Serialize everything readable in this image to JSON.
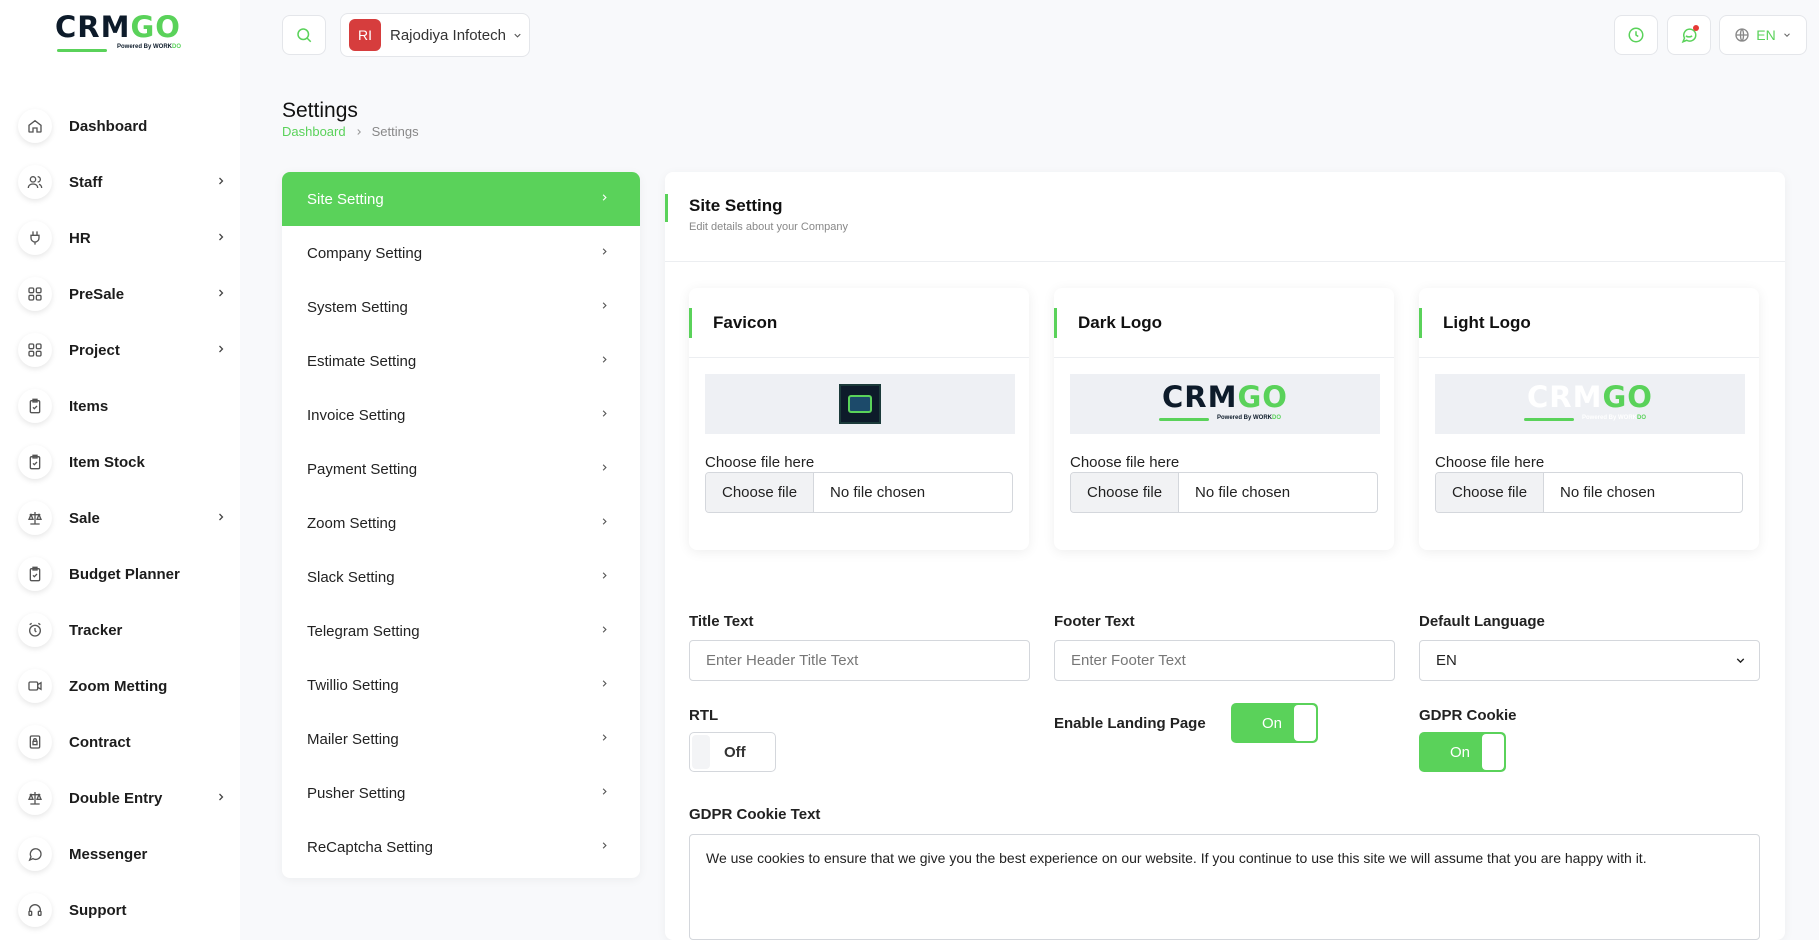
{
  "brand": {
    "word_part1": "CRM",
    "word_part2": "GO",
    "powered_by": "Powered By ",
    "powered_brand_part1": "WORK",
    "powered_brand_part2": "DO",
    "accent_color": "#5ad25a"
  },
  "sidebar": {
    "items": [
      {
        "label": "Dashboard",
        "icon": "home-icon",
        "has_children": false
      },
      {
        "label": "Staff",
        "icon": "users-icon",
        "has_children": true
      },
      {
        "label": "HR",
        "icon": "plug-icon",
        "has_children": true
      },
      {
        "label": "PreSale",
        "icon": "grid-icon",
        "has_children": true
      },
      {
        "label": "Project",
        "icon": "grid-icon",
        "has_children": true
      },
      {
        "label": "Items",
        "icon": "clipboard-check-icon",
        "has_children": false
      },
      {
        "label": "Item Stock",
        "icon": "clipboard-check-icon",
        "has_children": false
      },
      {
        "label": "Sale",
        "icon": "scale-icon",
        "has_children": true
      },
      {
        "label": "Budget Planner",
        "icon": "clipboard-check-icon",
        "has_children": false
      },
      {
        "label": "Tracker",
        "icon": "alarm-clock-icon",
        "has_children": false
      },
      {
        "label": "Zoom Metting",
        "icon": "video-icon",
        "has_children": false
      },
      {
        "label": "Contract",
        "icon": "file-lock-icon",
        "has_children": false
      },
      {
        "label": "Double Entry",
        "icon": "scale-icon",
        "has_children": true
      },
      {
        "label": "Messenger",
        "icon": "chat-bubble-icon",
        "has_children": false
      },
      {
        "label": "Support",
        "icon": "headset-icon",
        "has_children": false
      }
    ]
  },
  "topbar": {
    "company_initials": "RI",
    "company_name": "Rajodiya Infotech",
    "language": "EN"
  },
  "page": {
    "title": "Settings",
    "breadcrumb_home": "Dashboard",
    "breadcrumb_current": "Settings"
  },
  "settings_menu": {
    "items": [
      {
        "label": "Site Setting",
        "active": true
      },
      {
        "label": "Company Setting"
      },
      {
        "label": "System Setting"
      },
      {
        "label": "Estimate Setting"
      },
      {
        "label": "Invoice Setting"
      },
      {
        "label": "Payment Setting"
      },
      {
        "label": "Zoom Setting"
      },
      {
        "label": "Slack Setting"
      },
      {
        "label": "Telegram Setting"
      },
      {
        "label": "Twillio Setting"
      },
      {
        "label": "Mailer Setting"
      },
      {
        "label": "Pusher Setting"
      },
      {
        "label": "ReCaptcha Setting"
      }
    ]
  },
  "panel": {
    "title": "Site Setting",
    "subtitle": "Edit details about your Company",
    "cards": [
      {
        "title": "Favicon",
        "file_label": "Choose file here",
        "button": "Choose file",
        "file_status": "No file chosen"
      },
      {
        "title": "Dark Logo",
        "file_label": "Choose file here",
        "button": "Choose file",
        "file_status": "No file chosen"
      },
      {
        "title": "Light Logo",
        "file_label": "Choose file here",
        "button": "Choose file",
        "file_status": "No file chosen"
      }
    ],
    "title_text": {
      "label": "Title Text",
      "placeholder": "Enter Header Title Text",
      "value": ""
    },
    "footer_text": {
      "label": "Footer Text",
      "placeholder": "Enter Footer Text",
      "value": ""
    },
    "default_language": {
      "label": "Default Language",
      "value": "EN"
    },
    "rtl": {
      "label": "RTL",
      "state": "Off"
    },
    "landing_page": {
      "label": "Enable Landing Page",
      "state": "On"
    },
    "gdpr_cookie": {
      "label": "GDPR Cookie",
      "state": "On"
    },
    "gdpr_text": {
      "label": "GDPR Cookie Text",
      "value": "We use cookies to ensure that we give you the best experience on our website. If you continue to use this site we will assume that you are happy with it."
    }
  }
}
